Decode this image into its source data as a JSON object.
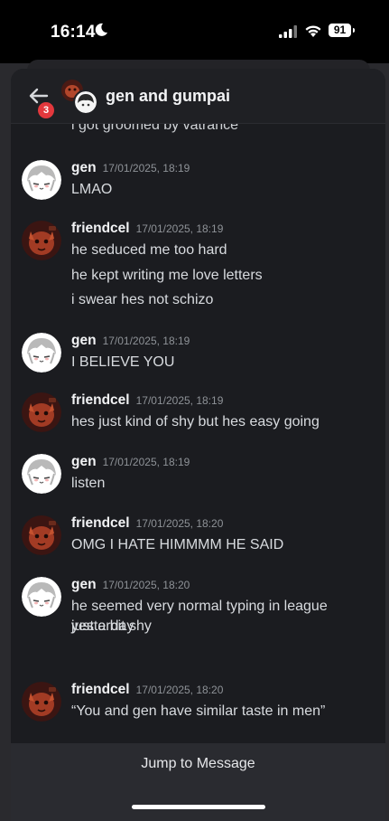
{
  "status_bar": {
    "time": "16:14",
    "battery": "91"
  },
  "header": {
    "badge": "3",
    "title": "gen and gumpai"
  },
  "partial_message": "i got groomed by vatrance",
  "messages": [
    {
      "author": "gen",
      "timestamp": "17/01/2025, 18:19",
      "lines": [
        "LMAO"
      ]
    },
    {
      "author": "friendcel",
      "timestamp": "17/01/2025, 18:19",
      "lines": [
        "he seduced me too hard",
        "he kept writing me love letters",
        "i swear hes not schizo"
      ]
    },
    {
      "author": "gen",
      "timestamp": "17/01/2025, 18:19",
      "lines": [
        "I BELIEVE YOU"
      ]
    },
    {
      "author": "friendcel",
      "timestamp": "17/01/2025, 18:19",
      "lines": [
        "hes just kind of shy but hes easy going"
      ]
    },
    {
      "author": "gen",
      "timestamp": "17/01/2025, 18:19",
      "lines": [
        "listen"
      ]
    },
    {
      "author": "friendcel",
      "timestamp": "17/01/2025, 18:20",
      "lines": [
        "OMG I HATE HIMMMM HE SAID"
      ]
    },
    {
      "author": "gen",
      "timestamp": "17/01/2025, 18:20",
      "lines": [
        "he seemed very normal typing in league yesterday",
        "just a bit shy"
      ]
    },
    {
      "author": "friendcel",
      "timestamp": "17/01/2025, 18:20",
      "lines": [
        "“You and gen have similar taste in men”"
      ]
    }
  ],
  "jump_button": "Jump to Message",
  "colors": {
    "background": "#1b1c20",
    "badge": "#e3383d",
    "jump_bar": "#2a2b30"
  }
}
